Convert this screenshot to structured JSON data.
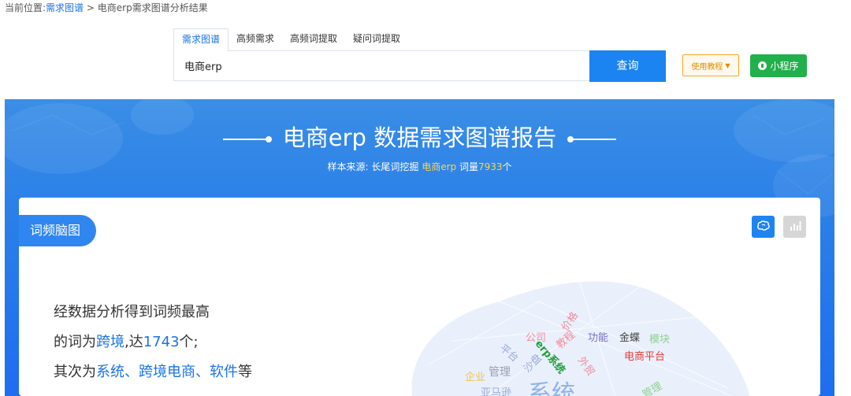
{
  "breadcrumb": {
    "prefix": "当前位置:",
    "link": "需求图谱",
    "separator": ">",
    "current": "电商erp需求图谱分析结果"
  },
  "tabs": [
    {
      "label": "需求图谱",
      "active": true
    },
    {
      "label": "高频需求",
      "active": false
    },
    {
      "label": "高频词提取",
      "active": false
    },
    {
      "label": "疑问词提取",
      "active": false
    }
  ],
  "search": {
    "value": "电商erp",
    "button_label": "查询"
  },
  "tutorial": {
    "label": "使用教程"
  },
  "mini_program": {
    "label": "小程序"
  },
  "report": {
    "keyword": "电商erp",
    "title": "电商erp 数据需求图谱报告",
    "source_label": "样本来源:",
    "source_site": "长尾词挖掘",
    "word_count_label": "词量",
    "word_count": "7933",
    "unit": "个"
  },
  "card": {
    "tag_label": "词频脑图"
  },
  "summary": {
    "line1": "经数据分析得到词频最高",
    "line2_prefix": "的词为",
    "top_word": "跨境",
    "line2_mid": ",达",
    "top_count": "1743",
    "line2_suffix": "个;",
    "line3_prefix": "其次为",
    "second_words": "系统、跨境电商、软件",
    "line3_suffix": "等"
  },
  "word_cloud": [
    {
      "text": "价格",
      "color": "#f28b9c"
    },
    {
      "text": "公司",
      "color": "#f28b9c"
    },
    {
      "text": "教程",
      "color": "#f28b9c"
    },
    {
      "text": "功能",
      "color": "#7b6fc4"
    },
    {
      "text": "金蝶",
      "color": "#444444"
    },
    {
      "text": "模块",
      "color": "#8ed08e"
    },
    {
      "text": "平台",
      "color": "#9aa9d6"
    },
    {
      "text": "erp系统",
      "color": "#1e9e3a"
    },
    {
      "text": "沙盘",
      "color": "#9aa9d6"
    },
    {
      "text": "外贸",
      "color": "#f28b9c"
    },
    {
      "text": "电商平台",
      "color": "#e53935"
    },
    {
      "text": "企业",
      "color": "#f0c24a"
    },
    {
      "text": "管理",
      "color": "#9aa0b5"
    },
    {
      "text": "亚马逊",
      "color": "#9aa9d6"
    },
    {
      "text": "系统",
      "color": "#8fb3ea"
    },
    {
      "text": "管理",
      "color": "#8ed08e"
    }
  ],
  "colors": {
    "primary": "#1c84f0",
    "green": "#21b04b",
    "orange": "#f5a623",
    "highlight": "#ffd54a"
  },
  "icons": [
    "brain-icon",
    "bar-chart-icon"
  ]
}
